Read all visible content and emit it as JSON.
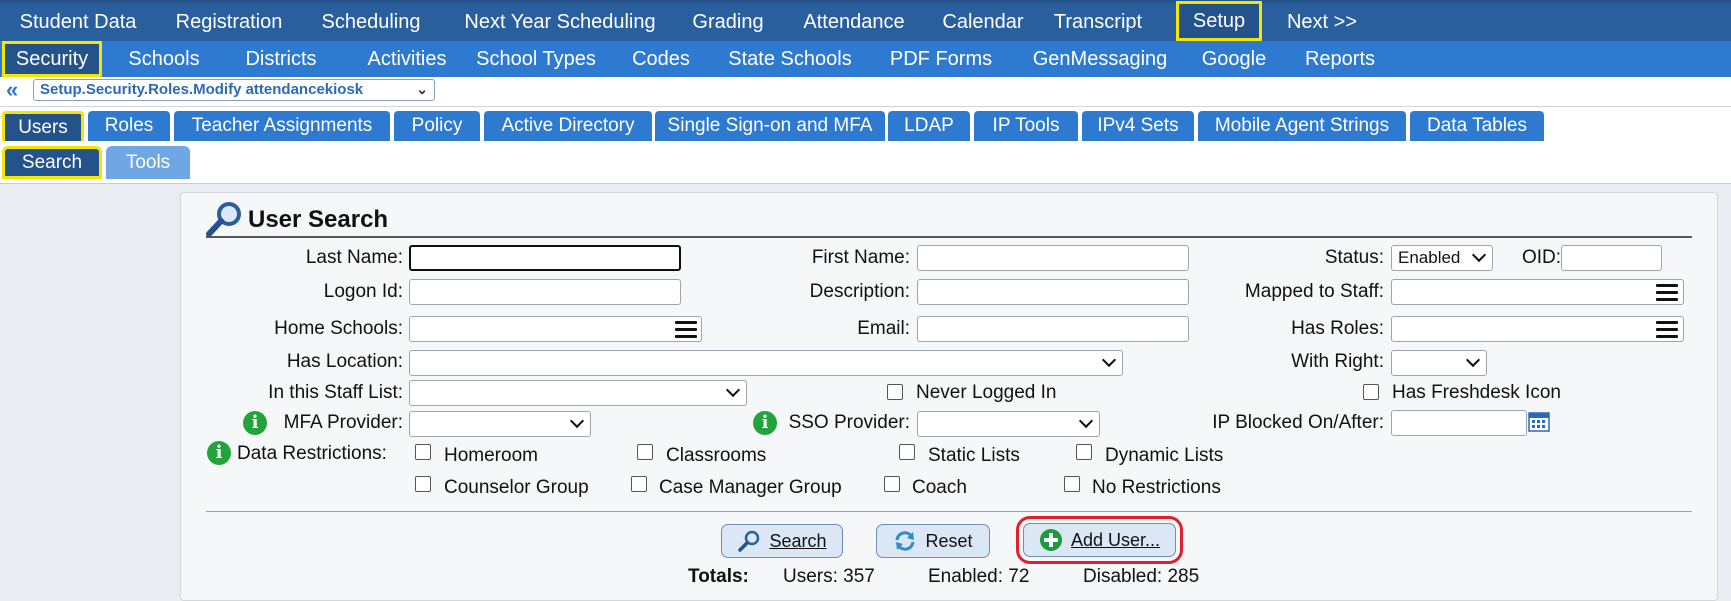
{
  "top_nav": {
    "items": [
      "Student Data",
      "Registration",
      "Scheduling",
      "Next Year Scheduling",
      "Grading",
      "Attendance",
      "Calendar",
      "Transcript",
      "Setup",
      "Next >>"
    ],
    "selected": "Setup"
  },
  "secondary_nav": {
    "items": [
      "Security",
      "Schools",
      "Districts",
      "Activities",
      "School Types",
      "Codes",
      "State Schools",
      "PDF Forms",
      "GenMessaging",
      "Google",
      "Reports"
    ],
    "selected": "Security"
  },
  "breadcrumb": {
    "value": "Setup.Security.Roles.Modify attendancekiosk"
  },
  "tabs": [
    "Users",
    "Roles",
    "Teacher Assignments",
    "Policy",
    "Active Directory",
    "Single Sign-on and MFA",
    "LDAP",
    "IP Tools",
    "IPv4 Sets",
    "Mobile Agent Strings",
    "Data Tables"
  ],
  "active_tab": "Users",
  "subtabs": [
    "Search",
    "Tools"
  ],
  "active_subtab": "Search",
  "panel": {
    "title": "User Search",
    "labels": {
      "last_name": "Last Name:",
      "first_name": "First Name:",
      "status": "Status:",
      "oid": "OID:",
      "logon_id": "Logon Id:",
      "description": "Description:",
      "mapped_to_staff": "Mapped to Staff:",
      "home_schools": "Home Schools:",
      "email": "Email:",
      "has_roles": "Has Roles:",
      "has_location": "Has Location:",
      "with_right": "With Right:",
      "staff_list": "In this Staff List:",
      "never_logged_in": "Never Logged In",
      "has_freshdesk": "Has Freshdesk Icon",
      "mfa_provider": "MFA Provider:",
      "sso_provider": "SSO Provider:",
      "ip_blocked": "IP Blocked On/After:",
      "data_restrictions": "Data Restrictions:"
    },
    "status_value": "Enabled",
    "restrictions": [
      "Homeroom",
      "Classrooms",
      "Static Lists",
      "Dynamic Lists",
      "Counselor Group",
      "Case Manager Group",
      "Coach",
      "No Restrictions"
    ]
  },
  "buttons": {
    "search": "Search",
    "reset": "Reset",
    "add_user": "Add User..."
  },
  "totals": {
    "label": "Totals:",
    "users": "Users: 357",
    "enabled": "Enabled: 72",
    "disabled": "Disabled: 285"
  },
  "colors": {
    "nav_dark": "#24528a",
    "nav": "#2f7ad1",
    "highlight": "#f3e600",
    "annotation_red": "#e0202a",
    "info_green": "#22a33b"
  }
}
